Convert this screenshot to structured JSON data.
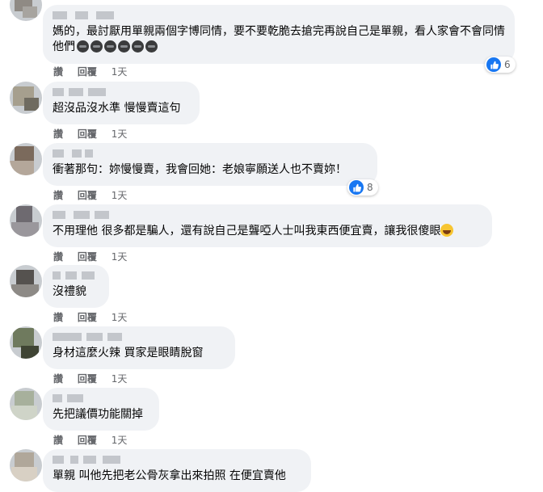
{
  "comments": [
    {
      "text": "媽的，最討厭用單親兩個字博同情，要不要乾脆去搶完再說自己是單親，看人家會不會同情他們",
      "emoji_count": 6,
      "reactions": "6"
    },
    {
      "text": "超沒品沒水準 慢慢賣這句",
      "reactions": null
    },
    {
      "text": "衝著那句：妳慢慢賣，我會回她：老娘寧願送人也不賣妳！",
      "reactions": "8"
    },
    {
      "text": "不用理他 很多都是騙人，還有說自己是聾啞人士叫我東西便宜賣，讓我很傻眼",
      "reactions": null
    },
    {
      "text": "沒禮貌",
      "reactions": null
    },
    {
      "text": "身材這麼火辣 買家是眼睛脫窗",
      "reactions": null
    },
    {
      "text": "先把議價功能關掉",
      "reactions": null
    },
    {
      "text": "單親 叫他先把老公骨灰拿出來拍照 在便宜賣他",
      "reactions": null
    }
  ],
  "actions": {
    "like": "讚",
    "reply": "回覆",
    "time": "1天"
  },
  "colors": {
    "bubble": "#f0f2f5",
    "like_blue": "#1877f2",
    "meta_text": "#65676b"
  },
  "icons": {
    "like": "thumbs-up-icon",
    "laugh": "laughing-emoji-icon",
    "dark_emoji": "dark-emoji-icon"
  }
}
